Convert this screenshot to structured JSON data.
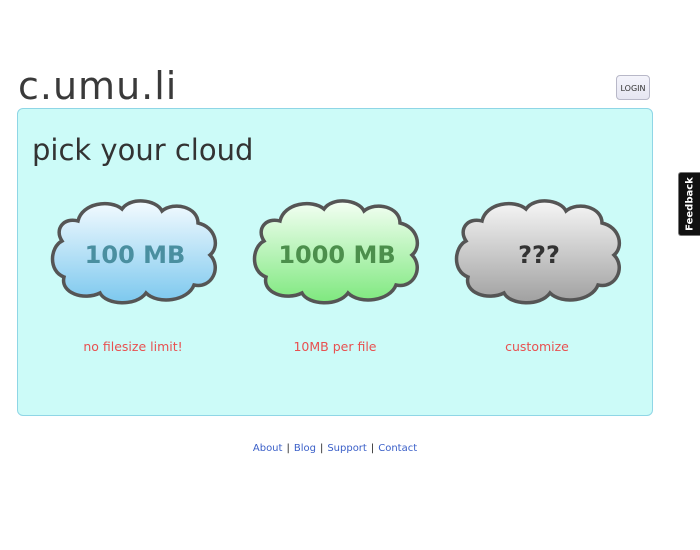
{
  "header": {
    "logo": "c.umu.li",
    "login_label": "LOGIN"
  },
  "main": {
    "title": "pick your cloud",
    "clouds": [
      {
        "label": "100 MB",
        "description": "no filesize limit!",
        "color": "#4a8fa0"
      },
      {
        "label": "1000 MB",
        "description": "10MB per file",
        "color": "#4c8f4c"
      },
      {
        "label": "???",
        "description": "customize",
        "color": "#333333"
      }
    ]
  },
  "footer": {
    "links": [
      "About",
      "Blog",
      "Support",
      "Contact"
    ],
    "separator": "|"
  },
  "feedback_tab": "Feedback",
  "colors": {
    "panel_bg": "#ccfbf8",
    "panel_border": "#8fd6e6",
    "description_text": "#e85050",
    "link": "#3a5fc8"
  },
  "icons": [
    "blue-cloud-icon",
    "green-cloud-icon",
    "gray-cloud-icon"
  ]
}
